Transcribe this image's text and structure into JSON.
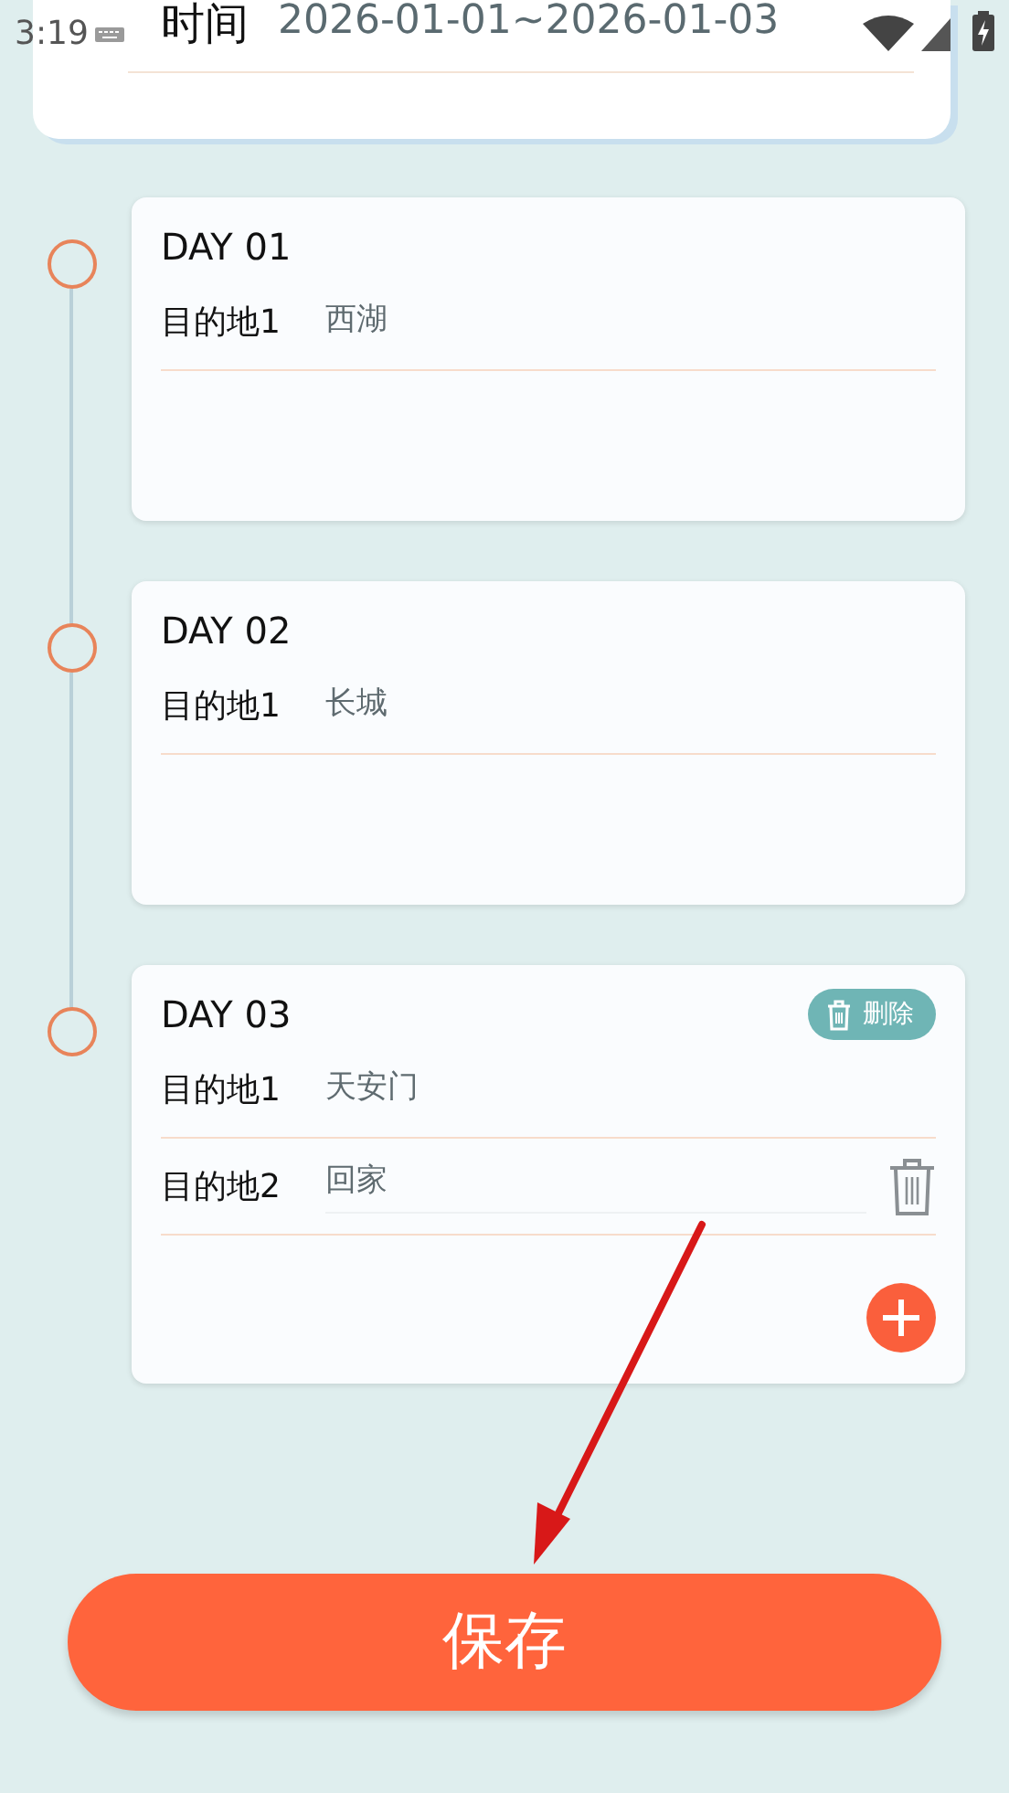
{
  "status_bar": {
    "time": "3:19"
  },
  "trip_card": {
    "label": "时间",
    "value": "2026-01-01~2026-01-03"
  },
  "days": [
    {
      "title": "DAY 01",
      "destinations": [
        {
          "label": "目的地1",
          "value": "西湖",
          "kind": "fixed"
        }
      ],
      "can_add": false
    },
    {
      "title": "DAY 02",
      "destinations": [
        {
          "label": "目的地1",
          "value": "长城",
          "kind": "fixed"
        }
      ],
      "can_add": false
    },
    {
      "title": "DAY 03",
      "delete_button": "删除",
      "destinations": [
        {
          "label": "目的地1",
          "value": "天安门",
          "kind": "fixed"
        },
        {
          "label": "目的地2",
          "value": "回家",
          "kind": "editable"
        }
      ],
      "can_add": true
    }
  ],
  "save_button": "保存"
}
